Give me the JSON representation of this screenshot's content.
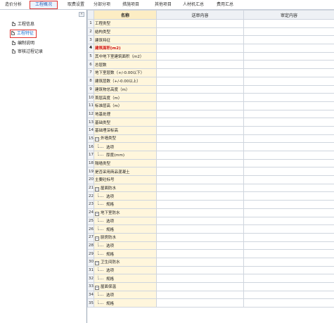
{
  "tabs": [
    {
      "label": "造价分析",
      "active": false
    },
    {
      "label": "工程概况",
      "active": true
    },
    {
      "label": "取费设置",
      "active": false
    },
    {
      "label": "分部分项",
      "active": false
    },
    {
      "label": "措施项目",
      "active": false
    },
    {
      "label": "其他项目",
      "active": false
    },
    {
      "label": "人材机汇总",
      "active": false
    },
    {
      "label": "费用汇总",
      "active": false
    }
  ],
  "collapse_glyph": "«",
  "tree": [
    {
      "label": "工程信息",
      "selected": false
    },
    {
      "label": "工程特征",
      "selected": true
    },
    {
      "label": "编制说明",
      "selected": false
    },
    {
      "label": "审核过程记录",
      "selected": false
    }
  ],
  "grid": {
    "headers": [
      "",
      "名称",
      "送审内容",
      "审定内容"
    ],
    "rows": [
      {
        "num": "1",
        "name": "工程类型",
        "level": 0
      },
      {
        "num": "2",
        "name": "结构类型",
        "level": 0
      },
      {
        "num": "3",
        "name": "建筑特征",
        "level": 0
      },
      {
        "num": "4",
        "name": "建筑面积(m2)",
        "level": 0,
        "highlight": true
      },
      {
        "num": "5",
        "name": "其中地下室建筑面积（m2）",
        "level": 0
      },
      {
        "num": "6",
        "name": "总层数",
        "level": 0
      },
      {
        "num": "7",
        "name": "地下室层数（+/-0.00以下）",
        "level": 0
      },
      {
        "num": "8",
        "name": "建筑层数（+/-0.00以上）",
        "level": 0
      },
      {
        "num": "9",
        "name": "建筑物总高度（m）",
        "level": 0
      },
      {
        "num": "10",
        "name": "首层高度（m）",
        "level": 0
      },
      {
        "num": "11",
        "name": "标准层高（m）",
        "level": 0
      },
      {
        "num": "12",
        "name": "地基处理",
        "level": 0
      },
      {
        "num": "13",
        "name": "基础类型",
        "level": 0
      },
      {
        "num": "14",
        "name": "基础埋深标高",
        "level": 0
      },
      {
        "num": "15",
        "name": "外墙类型",
        "level": 0,
        "expander": "−"
      },
      {
        "num": "16",
        "name": "选项",
        "level": 1
      },
      {
        "num": "17",
        "name": "厚度(mm)",
        "level": 1
      },
      {
        "num": "18",
        "name": "隔墙类型",
        "level": 0
      },
      {
        "num": "19",
        "name": "是否采用商品混凝土",
        "level": 0
      },
      {
        "num": "20",
        "name": "主要砼标号",
        "level": 0
      },
      {
        "num": "21",
        "name": "屋面防水",
        "level": 0,
        "expander": "−"
      },
      {
        "num": "22",
        "name": "选项",
        "level": 1
      },
      {
        "num": "23",
        "name": "规格",
        "level": 1
      },
      {
        "num": "24",
        "name": "地下室防水",
        "level": 0,
        "expander": "−"
      },
      {
        "num": "25",
        "name": "选项",
        "level": 1
      },
      {
        "num": "26",
        "name": "规格",
        "level": 1
      },
      {
        "num": "27",
        "name": "厨房防水",
        "level": 0,
        "expander": "−"
      },
      {
        "num": "28",
        "name": "选项",
        "level": 1
      },
      {
        "num": "29",
        "name": "规格",
        "level": 1
      },
      {
        "num": "30",
        "name": "卫生间防水",
        "level": 0,
        "expander": "−"
      },
      {
        "num": "31",
        "name": "选项",
        "level": 1
      },
      {
        "num": "32",
        "name": "规格",
        "level": 1
      },
      {
        "num": "33",
        "name": "屋面保温",
        "level": 0,
        "expander": "−"
      },
      {
        "num": "34",
        "name": "选项",
        "level": 1
      },
      {
        "num": "35",
        "name": "规格",
        "level": 1
      }
    ]
  },
  "colors": {
    "accent_red": "#e0302c",
    "name_col_bg": "#fff6dc",
    "highlight_text": "#d01010",
    "link_blue": "#1a6fd0"
  },
  "icons": {
    "tree_item": "document-icon",
    "collapse": "collapse-left-icon",
    "expand": "minus-box-icon"
  }
}
